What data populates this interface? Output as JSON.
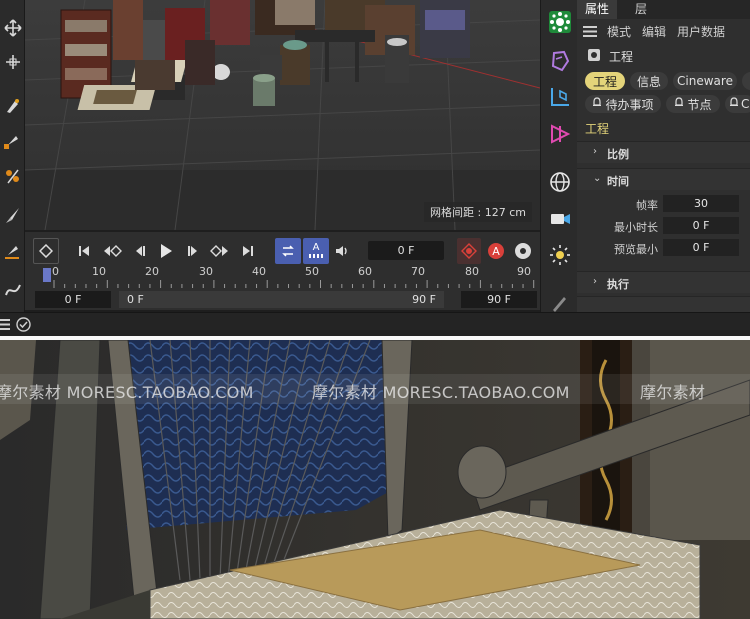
{
  "viewport": {
    "grid_spacing": "网格间距 : 127 cm"
  },
  "timeline": {
    "current_frame": "0 F",
    "ticks": [
      "0",
      "10",
      "20",
      "30",
      "40",
      "50",
      "60",
      "70",
      "80",
      "90"
    ],
    "range_start": "0 F",
    "range_min": "0 F",
    "range_max": "90 F",
    "range_end": "90 F",
    "auto_key_label": "A"
  },
  "attributes": {
    "tabs": [
      "属性",
      "层"
    ],
    "menu": [
      "模式",
      "编辑",
      "用户数据"
    ],
    "object_name": "工程",
    "main_tabs": [
      "工程",
      "信息",
      "Cineware"
    ],
    "sub_tabs": [
      "待办事项",
      "节点",
      "C"
    ],
    "section_title": "工程",
    "groups": {
      "scale": "比例",
      "time": "时间",
      "execute": "执行"
    },
    "params": [
      {
        "label": "帧率",
        "value": "30"
      },
      {
        "label": "最小时长",
        "value": "0 F"
      },
      {
        "label": "预览最小",
        "value": "0 F"
      }
    ]
  },
  "watermark": {
    "text_a": "摩尔素材 MORESC.TAOBAO.COM",
    "text_b": "摩尔素材 MORESC.TAOBAO.COM",
    "text_c": "摩尔素材"
  },
  "colors": {
    "accent": "#e4d47a",
    "loop_active": "#4a5fb0",
    "record": "#d9403a"
  }
}
